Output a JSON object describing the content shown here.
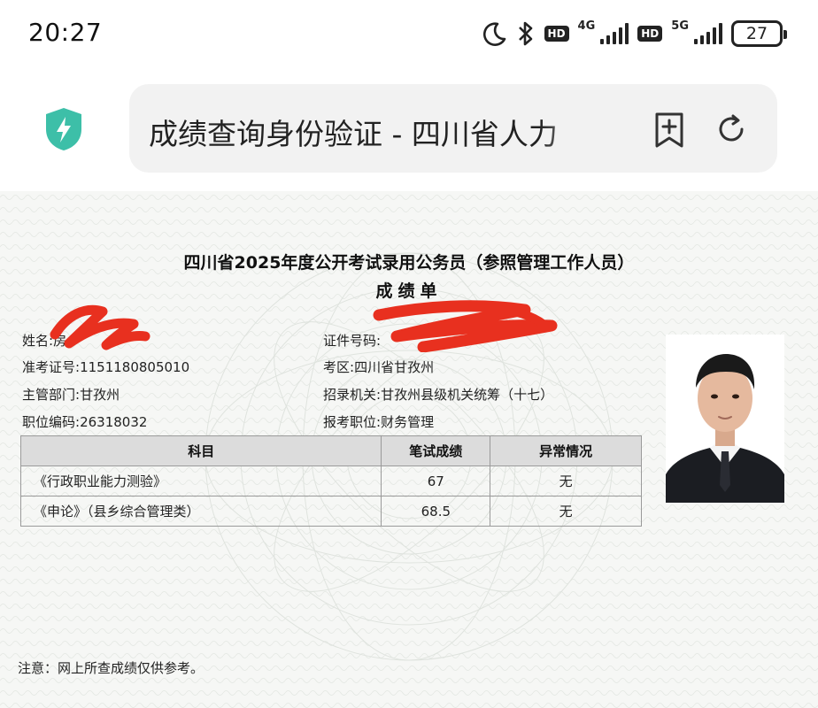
{
  "status_bar": {
    "time": "20:27",
    "icons": [
      "moon-icon",
      "bluetooth-icon",
      "hd-icon",
      "signal-4g-icon",
      "hd-icon",
      "signal-5g-icon",
      "battery-icon"
    ],
    "hd_label": "HD",
    "network_1": "4G",
    "network_2": "5G",
    "battery_level": "27"
  },
  "browser": {
    "page_title": "成绩查询身份验证 - 四川省人力",
    "security_icon": "shield-bolt-icon",
    "accent_color": "#3dbfa8",
    "bookmark_icon": "add-bookmark-icon",
    "reload_icon": "reload-icon"
  },
  "document": {
    "title": "四川省2025年度公开考试录用公务员（参照管理工作人员）",
    "subtitle": "成绩单",
    "fields": {
      "name_label": "姓名:",
      "name_value": "房",
      "id_label": "证件号码:",
      "exam_no_label": "准考证号:",
      "exam_no_value": "1151180805010",
      "exam_area_label": "考区:",
      "exam_area_value": "四川省甘孜州",
      "dept_label": "主管部门:",
      "dept_value": "甘孜州",
      "recruit_label": "招录机关:",
      "recruit_value": "甘孜州县级机关统筹（十七）",
      "position_code_label": "职位编码:",
      "position_code_value": "26318032",
      "position_label": "报考职位:",
      "position_value": "财务管理"
    },
    "table": {
      "headers": [
        "科目",
        "笔试成绩",
        "异常情况"
      ],
      "rows": [
        {
          "subject": "《行政职业能力测验》",
          "score": "67",
          "abnormal": "无"
        },
        {
          "subject": "《申论》（县乡综合管理类）",
          "score": "68.5",
          "abnormal": "无"
        }
      ]
    },
    "note": "注意：网上所查成绩仅供参考。",
    "redaction_color": "#e8301f"
  }
}
